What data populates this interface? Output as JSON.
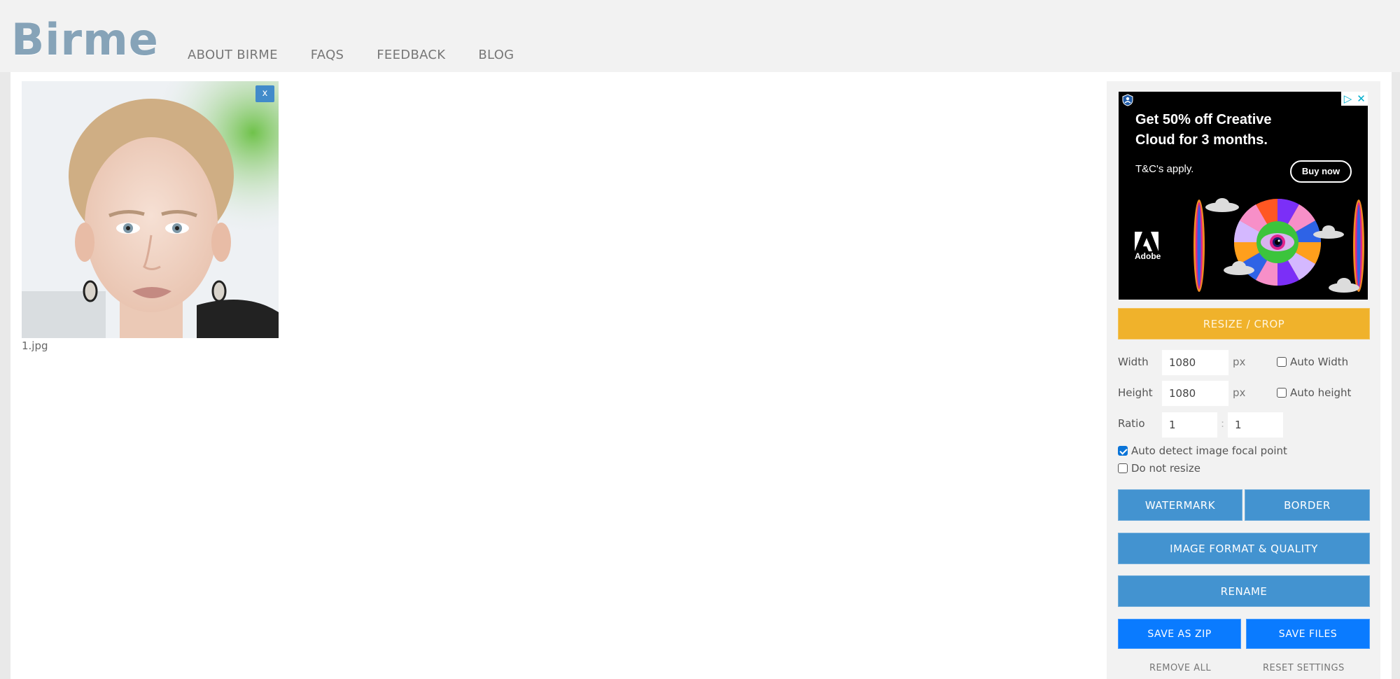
{
  "header": {
    "logo": "Birme",
    "nav": [
      {
        "label": "ABOUT BIRME"
      },
      {
        "label": "FAQS"
      },
      {
        "label": "FEEDBACK"
      },
      {
        "label": "BLOG"
      }
    ],
    "logo_color": "#86a3b8"
  },
  "gallery": {
    "images": [
      {
        "filename": "1.jpg",
        "remove_label": "x"
      }
    ]
  },
  "ad": {
    "headline_line1": "Get 50% off Creative",
    "headline_line2": "Cloud for 3 months.",
    "terms": "T&C's apply.",
    "cta": "Buy now",
    "brand": "Adobe",
    "info_icon": "adchoices-icon",
    "close_icon": "close-icon"
  },
  "settings": {
    "resize_crop_label": "RESIZE / CROP",
    "width_label": "Width",
    "width_value": "1080",
    "height_label": "Height",
    "height_value": "1080",
    "unit": "px",
    "auto_width_label": "Auto Width",
    "auto_width_checked": false,
    "auto_height_label": "Auto height",
    "auto_height_checked": false,
    "ratio_label": "Ratio",
    "ratio_w": "1",
    "ratio_sep": ":",
    "ratio_h": "1",
    "focal_label": "Auto detect image focal point",
    "focal_checked": true,
    "no_resize_label": "Do not resize",
    "no_resize_checked": false
  },
  "actions": {
    "watermark": "WATERMARK",
    "border": "BORDER",
    "format_quality": "IMAGE FORMAT & QUALITY",
    "rename": "RENAME",
    "save_zip": "SAVE AS ZIP",
    "save_files": "SAVE FILES",
    "remove_all": "REMOVE ALL",
    "reset_settings": "RESET SETTINGS"
  },
  "colors": {
    "accent_orange": "#f0b22b",
    "accent_blue": "#4393d0",
    "save_blue": "#0a7bff"
  }
}
